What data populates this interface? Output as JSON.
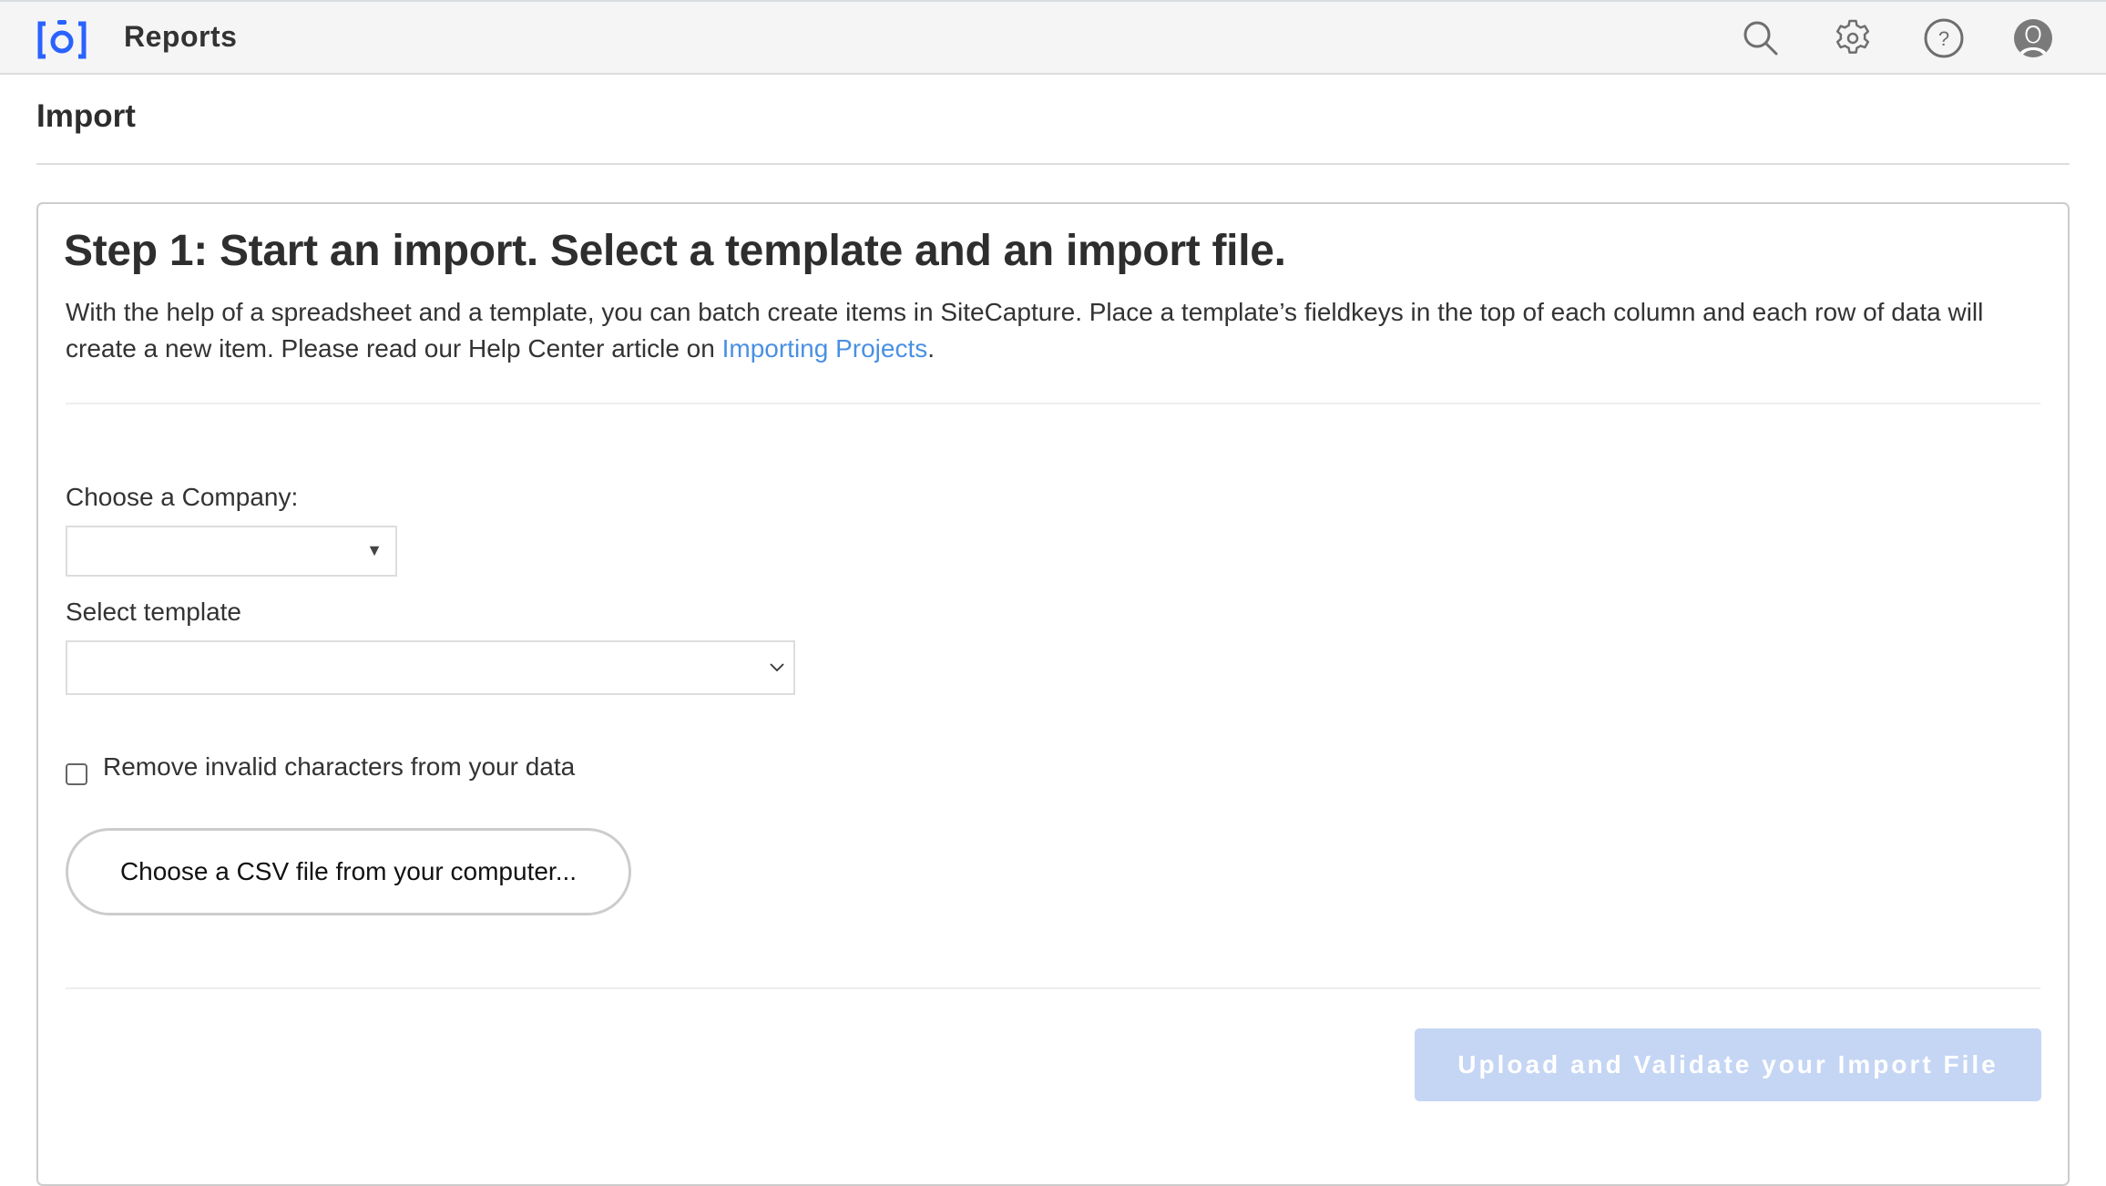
{
  "header": {
    "app_title": "Reports",
    "brand_color": "#2962ff",
    "icons": [
      "search-icon",
      "gear-icon",
      "help-icon",
      "user-avatar-icon"
    ]
  },
  "page": {
    "title": "Import"
  },
  "step": {
    "title": "Step 1: Start an import. Select a template and an import file.",
    "description_before_link": "With the help of a spreadsheet and a template, you can batch create items in SiteCapture. Place a template’s fieldkeys in the top of each column and each row of data will create a new item. Please read our Help Center article on ",
    "link_text": "Importing Projects",
    "description_after_link": ".",
    "link_color": "#4a90e2"
  },
  "form": {
    "company_label": "Choose a Company:",
    "company_value": "",
    "template_label": "Select template",
    "template_value": "",
    "remove_invalid_label": "Remove invalid characters from your data",
    "remove_invalid_checked": false,
    "csv_button_label": "Choose a CSV file from your computer...",
    "upload_button_label": "Upload and Validate your Import File",
    "upload_button_disabled": true,
    "upload_button_color": "#c5d5f4"
  }
}
